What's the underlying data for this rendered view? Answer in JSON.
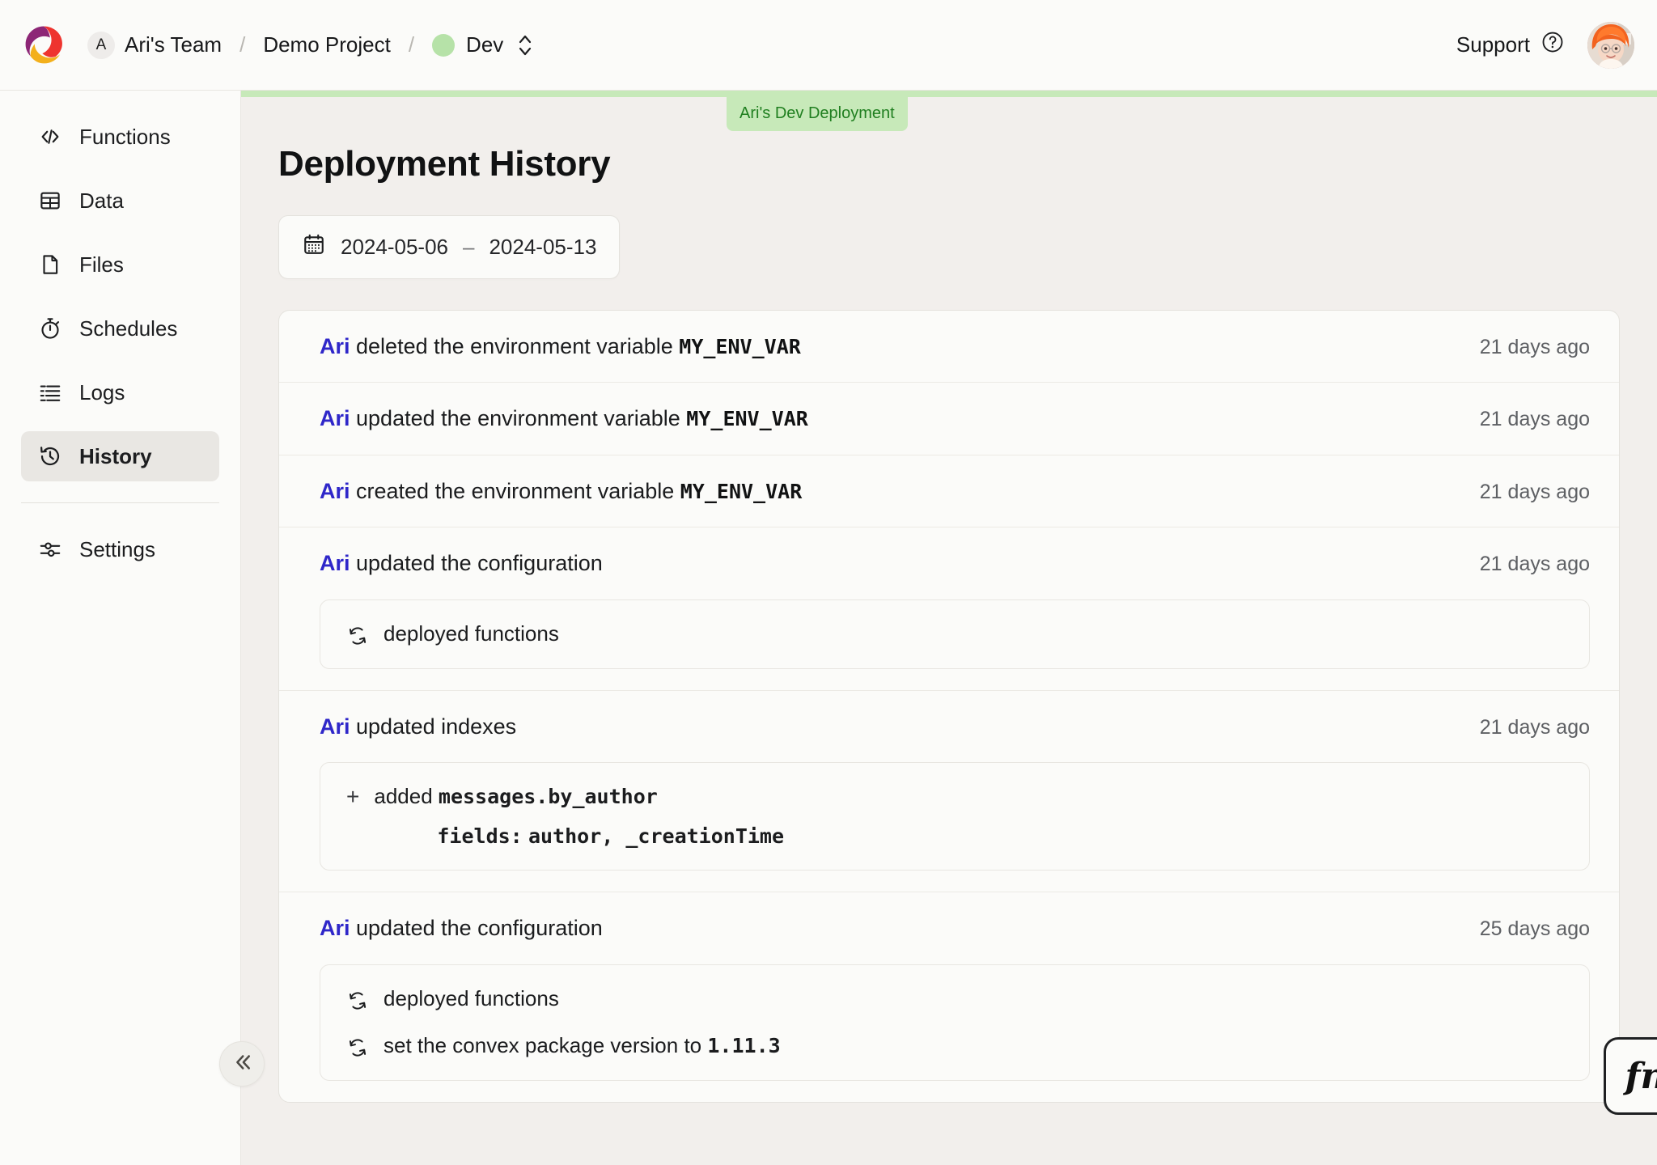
{
  "topbar": {
    "logo_icon": "convex-logo",
    "team_initial": "A",
    "team_name": "Ari's Team",
    "separator": "/",
    "project_name": "Demo Project",
    "deployment_name": "Dev",
    "deployment_dot_color": "#b6e2a8",
    "selector_icon": "chevron-up-down-icon",
    "support_label": "Support",
    "support_icon": "question-circle-icon",
    "avatar_icon": "user-avatar"
  },
  "sidebar": {
    "items": [
      {
        "label": "Functions",
        "icon": "code-brackets-icon",
        "active": false
      },
      {
        "label": "Data",
        "icon": "table-icon",
        "active": false
      },
      {
        "label": "Files",
        "icon": "file-icon",
        "active": false
      },
      {
        "label": "Schedules",
        "icon": "stopwatch-icon",
        "active": false
      },
      {
        "label": "Logs",
        "icon": "list-lines-icon",
        "active": false
      },
      {
        "label": "History",
        "icon": "clock-rewind-icon",
        "active": true
      }
    ],
    "footer_items": [
      {
        "label": "Settings",
        "icon": "sliders-icon",
        "active": false
      }
    ],
    "collapse_icon": "double-chevron-left-icon"
  },
  "main": {
    "deployment_badge": "Ari's Dev Deployment",
    "page_title": "Deployment History",
    "date_range": {
      "icon": "calendar-icon",
      "start": "2024-05-06",
      "separator": "–",
      "end": "2024-05-13"
    },
    "entries": [
      {
        "actor": "Ari",
        "action": " deleted the environment variable ",
        "target": "MY_ENV_VAR",
        "time": "21 days ago",
        "details": []
      },
      {
        "actor": "Ari",
        "action": " updated the environment variable ",
        "target": "MY_ENV_VAR",
        "time": "21 days ago",
        "details": []
      },
      {
        "actor": "Ari",
        "action": " created the environment variable ",
        "target": "MY_ENV_VAR",
        "time": "21 days ago",
        "details": []
      },
      {
        "actor": "Ari",
        "action": " updated the configuration",
        "target": "",
        "time": "21 days ago",
        "details": [
          {
            "kind": "deploy",
            "icon": "sync-arrows-icon",
            "text": "deployed functions",
            "strong": ""
          }
        ]
      },
      {
        "actor": "Ari",
        "action": " updated indexes",
        "target": "",
        "time": "21 days ago",
        "details": [
          {
            "kind": "index",
            "icon": "plus-icon",
            "prefix": "added ",
            "index_name": "messages.by_author",
            "fields_label": "fields:",
            "fields": "author, _creationTime"
          }
        ]
      },
      {
        "actor": "Ari",
        "action": " updated the configuration",
        "target": "",
        "time": "25 days ago",
        "details": [
          {
            "kind": "deploy",
            "icon": "sync-arrows-icon",
            "text": "deployed functions",
            "strong": ""
          },
          {
            "kind": "deploy",
            "icon": "sync-arrows-icon",
            "text": "set the convex package version to ",
            "strong": "1.11.3"
          }
        ]
      }
    ]
  },
  "fn_widget": {
    "label": "fn",
    "icon": "fn-icon"
  }
}
